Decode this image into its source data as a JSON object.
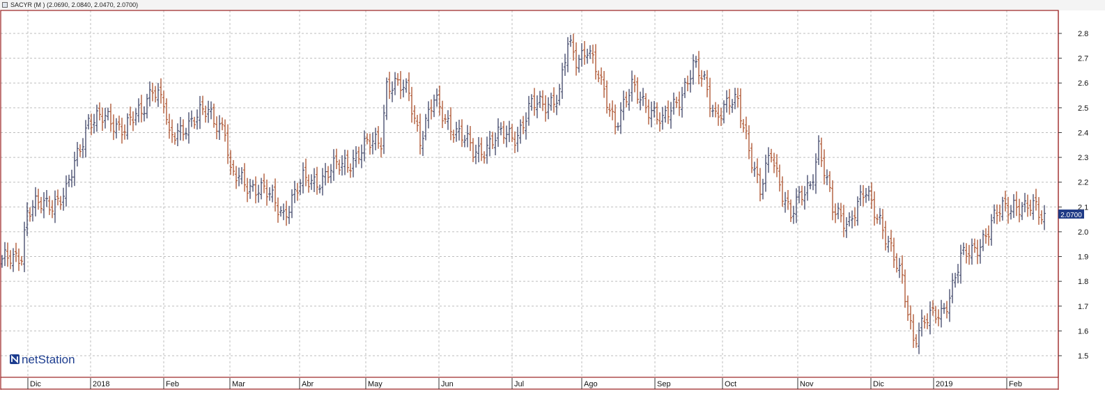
{
  "header": {
    "instrument": "SACYR",
    "period": "(M )",
    "ohlc": "(2.0690, 2.0840, 2.0470, 2.0700)"
  },
  "logo": {
    "text": "netStation",
    "icon": "n-logo-icon"
  },
  "colors": {
    "up": "#4a5070",
    "down": "#b05a38",
    "frame": "#9a2020",
    "grid": "#bdbdbd",
    "tag": "#1f3b86"
  },
  "last_price": "2.0700",
  "chart_data": {
    "type": "ohlc",
    "title": "SACYR (M )",
    "ylim": [
      1.44,
      2.88
    ],
    "y_ticks": [
      "1.5",
      "1.6",
      "1.7",
      "1.8",
      "1.9",
      "2.0",
      "2.1",
      "2.2",
      "2.3",
      "2.4",
      "2.5",
      "2.6",
      "2.7",
      "2.8"
    ],
    "x_labels": [
      "Dic",
      "2018",
      "Feb",
      "Mar",
      "Abr",
      "May",
      "Jun",
      "Jul",
      "Ago",
      "Sep",
      "Oct",
      "Nov",
      "Dic",
      "2019",
      "Feb"
    ],
    "grid": true,
    "anchors": [
      [
        0,
        1.87
      ],
      [
        7,
        1.92
      ],
      [
        9,
        2.08
      ],
      [
        23,
        2.15
      ],
      [
        31,
        2.46
      ],
      [
        44,
        2.43
      ],
      [
        50,
        2.47
      ],
      [
        54,
        2.6
      ],
      [
        58,
        2.52
      ],
      [
        60,
        2.36
      ],
      [
        66,
        2.44
      ],
      [
        74,
        2.48
      ],
      [
        80,
        2.42
      ],
      [
        82,
        2.22
      ],
      [
        92,
        2.18
      ],
      [
        101,
        2.08
      ],
      [
        108,
        2.2
      ],
      [
        115,
        2.22
      ],
      [
        126,
        2.3
      ],
      [
        136,
        2.38
      ],
      [
        138,
        2.6
      ],
      [
        146,
        2.56
      ],
      [
        150,
        2.38
      ],
      [
        155,
        2.52
      ],
      [
        160,
        2.45
      ],
      [
        169,
        2.32
      ],
      [
        180,
        2.39
      ],
      [
        185,
        2.4
      ],
      [
        190,
        2.5
      ],
      [
        200,
        2.55
      ],
      [
        203,
        2.75
      ],
      [
        206,
        2.7
      ],
      [
        210,
        2.75
      ],
      [
        215,
        2.58
      ],
      [
        220,
        2.45
      ],
      [
        226,
        2.57
      ],
      [
        233,
        2.5
      ],
      [
        237,
        2.43
      ],
      [
        244,
        2.57
      ],
      [
        248,
        2.66
      ],
      [
        252,
        2.6
      ],
      [
        256,
        2.48
      ],
      [
        264,
        2.52
      ],
      [
        267,
        2.4
      ],
      [
        272,
        2.15
      ],
      [
        276,
        2.32
      ],
      [
        283,
        2.06
      ],
      [
        290,
        2.2
      ],
      [
        293,
        2.35
      ],
      [
        298,
        2.08
      ],
      [
        304,
        2.05
      ],
      [
        310,
        2.15
      ],
      [
        315,
        2.06
      ],
      [
        320,
        1.88
      ],
      [
        323,
        1.8
      ],
      [
        327,
        1.58
      ],
      [
        330,
        1.62
      ],
      [
        337,
        1.68
      ],
      [
        340,
        1.75
      ],
      [
        344,
        1.88
      ],
      [
        349,
        1.94
      ],
      [
        354,
        2.0
      ],
      [
        359,
        2.1
      ],
      [
        363,
        2.12
      ],
      [
        367,
        2.08
      ],
      [
        371,
        2.1
      ],
      [
        374,
        2.07
      ]
    ]
  }
}
